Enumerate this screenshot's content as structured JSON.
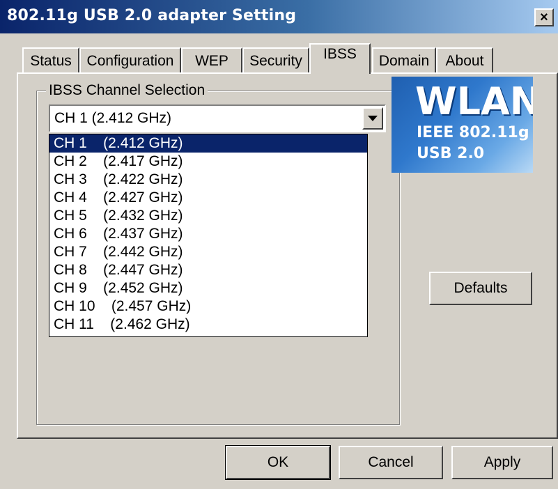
{
  "window": {
    "title": "802.11g USB 2.0 adapter Setting",
    "close_label": "×"
  },
  "tabs": [
    {
      "label": "Status"
    },
    {
      "label": "Configuration"
    },
    {
      "label": "WEP"
    },
    {
      "label": "Security"
    },
    {
      "label": "IBSS",
      "active": true
    },
    {
      "label": "Domain"
    },
    {
      "label": "About"
    }
  ],
  "ibss": {
    "group_label": "IBSS Channel Selection",
    "selected_value": "CH 1    (2.412 GHz)",
    "channels": [
      "CH 1    (2.412 GHz)",
      "CH 2    (2.417 GHz)",
      "CH 3    (2.422 GHz)",
      "CH 4    (2.427 GHz)",
      "CH 5    (2.432 GHz)",
      "CH 6    (2.437 GHz)",
      "CH 7    (2.442 GHz)",
      "CH 8    (2.447 GHz)",
      "CH 9    (2.452 GHz)",
      "CH 10    (2.457 GHz)",
      "CH 11    (2.462 GHz)"
    ],
    "highlighted_index": 0
  },
  "logo": {
    "big": "WLAN",
    "line1": "IEEE 802.11g",
    "line2": "USB 2.0"
  },
  "buttons": {
    "defaults": "Defaults",
    "ok": "OK",
    "cancel": "Cancel",
    "apply": "Apply"
  },
  "colors": {
    "selection": "#0a246a",
    "titlebar_start": "#0a246a",
    "face": "#d4d0c8"
  }
}
